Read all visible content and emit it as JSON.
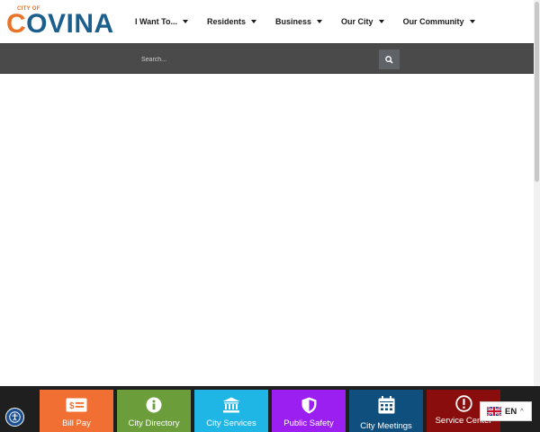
{
  "logo": {
    "city_of": "CITY OF",
    "first": "C",
    "rest": "OVINA"
  },
  "nav": [
    {
      "label": "I Want To..."
    },
    {
      "label": "Residents"
    },
    {
      "label": "Business"
    },
    {
      "label": "Our City"
    },
    {
      "label": "Our Community"
    }
  ],
  "search": {
    "placeholder": "Search..."
  },
  "tiles": [
    {
      "label": "Bill Pay",
      "icon": "bill-icon",
      "color": "#f26f33"
    },
    {
      "label": "City Directory",
      "icon": "info-icon",
      "color": "#6b9e3a"
    },
    {
      "label": "City Services",
      "icon": "building-icon",
      "color": "#1fb6e6"
    },
    {
      "label": "Public Safety",
      "icon": "shield-icon",
      "color": "#9b1ff0"
    },
    {
      "label": "City Meetings",
      "icon": "calendar-icon",
      "color": "#0f4f7d"
    },
    {
      "label": "Service Center",
      "icon": "alert-icon",
      "color": "#8a0d0d"
    }
  ],
  "language": {
    "code": "EN",
    "flag": "uk-flag-icon"
  },
  "accessibility": {
    "icon": "accessibility-icon"
  }
}
